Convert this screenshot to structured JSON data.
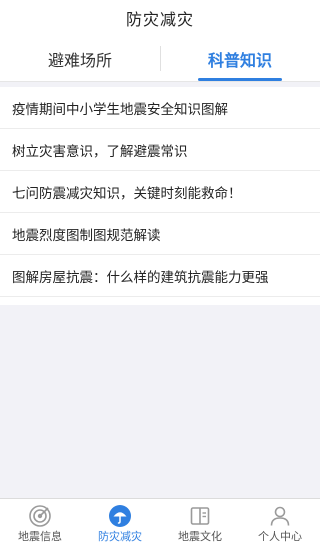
{
  "header": {
    "title": "防灾减灾"
  },
  "tabs": [
    {
      "label": "避难场所",
      "active": false
    },
    {
      "label": "科普知识",
      "active": true
    }
  ],
  "articles": [
    "疫情期间中小学生地震安全知识图解",
    "树立灾害意识，了解避震常识",
    "七问防震减灾知识，关键时刻能救命！",
    "地震烈度图制图规范解读",
    "图解房屋抗震：什么样的建筑抗震能力更强"
  ],
  "bottom_nav": [
    {
      "label": "地震信息",
      "icon": "seismic-target-icon",
      "active": false
    },
    {
      "label": "防灾减灾",
      "icon": "umbrella-icon",
      "active": true
    },
    {
      "label": "地震文化",
      "icon": "book-icon",
      "active": false
    },
    {
      "label": "个人中心",
      "icon": "person-icon",
      "active": false
    }
  ],
  "colors": {
    "accent": "#2f7fe0",
    "inactive_icon": "#9a9a9a",
    "background": "#f2f2f7"
  }
}
